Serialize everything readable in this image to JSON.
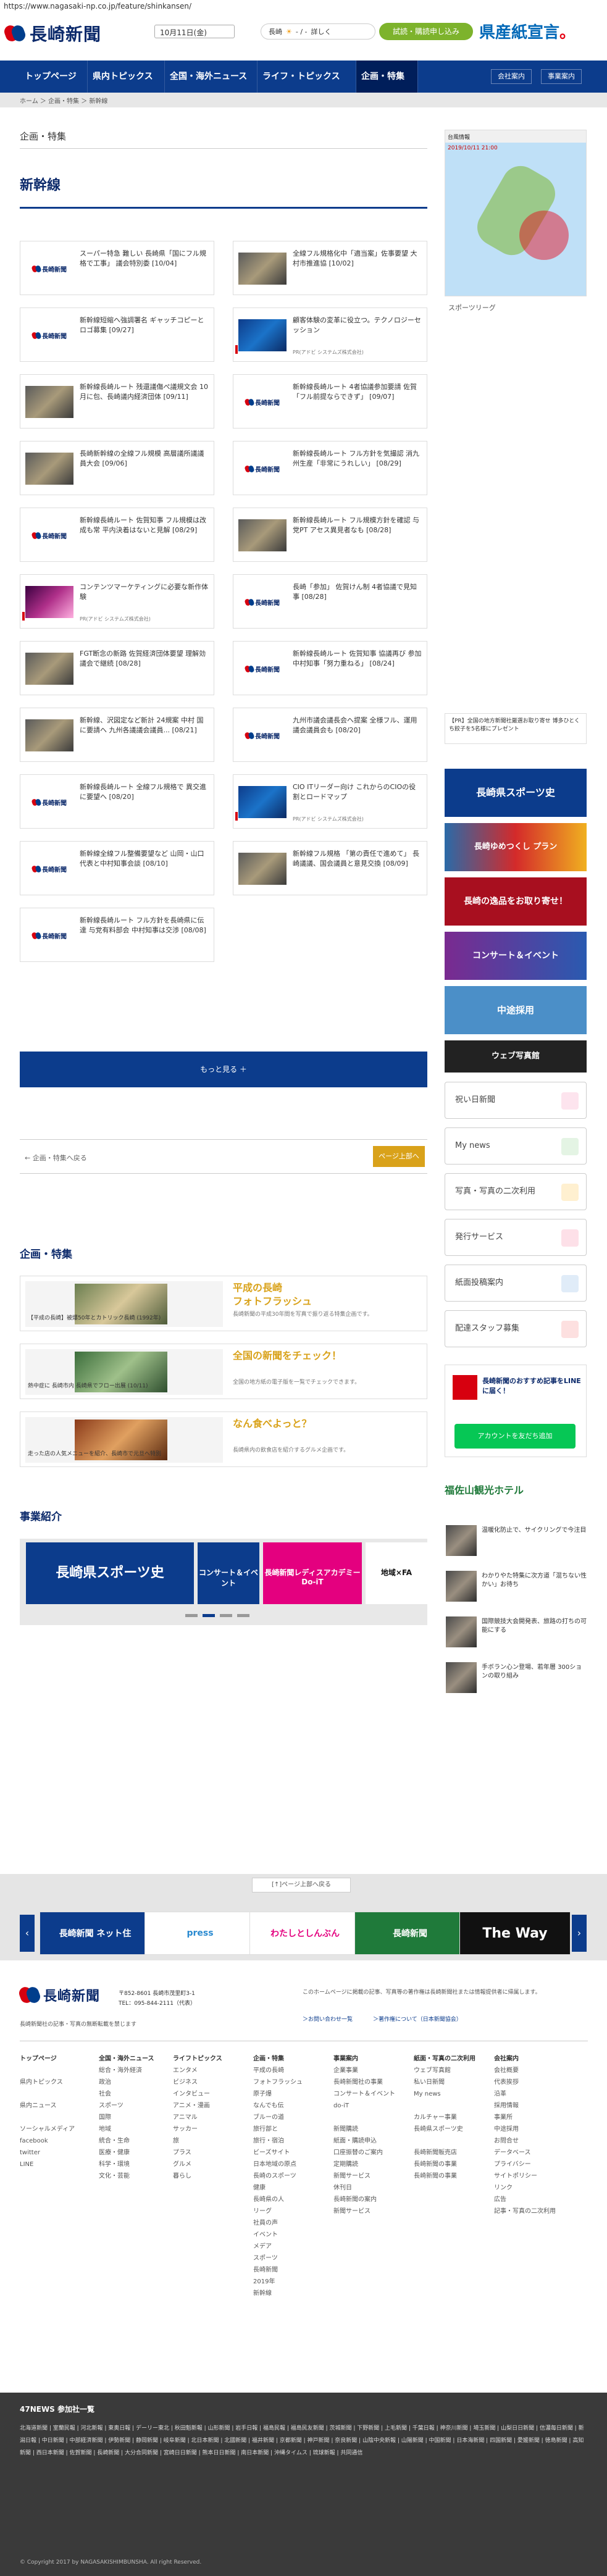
{
  "url": "https://www.nagasaki-np.co.jp/feature/shinkansen/",
  "header": {
    "logo_text": "長崎新聞",
    "date": "10月11日(金)",
    "weather_label": "長崎",
    "weather_values": "- / -",
    "weather_link": "詳しく",
    "trial_button": "試読・購読申し込み",
    "kenshi_text": "県産紙宣言"
  },
  "nav": {
    "items": [
      "トップページ",
      "県内トピックス",
      "全国・海外ニュース",
      "ライフ・トピックス",
      "企画・特集"
    ],
    "right": [
      "会社案内",
      "事業案内"
    ]
  },
  "breadcrumb": "ホーム ＞ 企画・特集 ＞ 新幹線",
  "section_title": "企画・特集",
  "page_title": "新幹線",
  "articles": [
    {
      "text": "スーパー特急 難しい 長崎県「国にフル規格で工事」 議会特別委 [10/04]",
      "thumb": "logo"
    },
    {
      "text": "全線フル規格化中「適当案」佐事要望 大村市推進協 [10/02]",
      "thumb": "photo"
    },
    {
      "text": "新幹線短縮へ強調署名 ギャッチコピーとロゴ募集 [09/27]",
      "thumb": "logo"
    },
    {
      "text": "顧客体験の変革に役立つ。テクノロジーセッション",
      "thumb": "blue",
      "pr": "PR(アドビ システムズ株式会社)"
    },
    {
      "text": "新幹線長崎ルート 残還議傷ぺ議規文会 10月に包、長崎議内経済団体 [09/11]",
      "thumb": "photo"
    },
    {
      "text": "新幹線長崎ルート 4者協議参加要請 佐賀「フル前提ならできず」 [09/07]",
      "thumb": "logo"
    },
    {
      "text": "長崎新幹線の全線フル規模 高層議所議議員大会 [09/06]",
      "thumb": "photo"
    },
    {
      "text": "新幹線長崎ルート フル方針を気撮認 消九州生産「非常にうれしい」 [08/29]",
      "thumb": "logo"
    },
    {
      "text": "新幹線長崎ルート 佐賀知事 フル規模は改成も常 平内決着はないと見解 [08/29]",
      "thumb": "logo"
    },
    {
      "text": "新幹線長崎ルート フル規模方針を確認 与党PT アセス異見者なも [08/28]",
      "thumb": "photo"
    },
    {
      "text": "コンテンツマーケティングに必要な新作体験",
      "thumb": "pink",
      "pr": "PR(アドビ システムズ株式会社)"
    },
    {
      "text": "長崎「参加」 佐賀けん制 4者協議で見知事 [08/28]",
      "thumb": "logo"
    },
    {
      "text": "FGT断念の新路 佐賀経済団体要望 理解効議会で継続 [08/28]",
      "thumb": "photo"
    },
    {
      "text": "新幹線長崎ルート 佐賀知事 協議再び 参加 中村知事「努力重ねる」 [08/24]",
      "thumb": "logo"
    },
    {
      "text": "新幹線、沢図定など新計 24規案 中村 国に要請へ 九州各議議会議員... [08/21]",
      "thumb": "photo"
    },
    {
      "text": "九州市議会議長会へ提案 全様フル、運用議会議員会も [08/20]",
      "thumb": "logo"
    },
    {
      "text": "新幹線長崎ルート 全線フル規格で 異交進に要望へ [08/20]",
      "thumb": "logo"
    },
    {
      "text": "CIO ITリーダー向け これからのCIOの役割とロードマップ",
      "thumb": "blue",
      "pr": "PR(アドビ システムズ株式会社)"
    },
    {
      "text": "新幹線全線フル整備要望など 山岡・山口代表と中村知事会談 [08/10]",
      "thumb": "logo"
    },
    {
      "text": "新幹線フル規格 「第の責任で進めて」 長崎議議、国会議員と意見交換 [08/09]",
      "thumb": "photo"
    },
    {
      "text": "新幹線長崎ルート フル方針を長崎県に伝達 与党有料部会 中村知事は交渉 [08/08]",
      "thumb": "logo"
    }
  ],
  "more_button": "もっと見る ＋",
  "back_link": "← 企画・特集へ戻る",
  "page_top": "ページ上部へ",
  "features_heading": "企画・特集",
  "features": [
    {
      "title": "平成の長崎\nフォトフラッシュ",
      "caption": "【平成の長崎】被爆50年とカトリック長崎 (1992年)",
      "desc": "長崎新聞の平成30年間を写真で振り返る特集企画です。"
    },
    {
      "title": "全国の新聞をチェック！",
      "caption": "熱中症に 長崎市内 長崎県でフロー出展 (10/11)",
      "desc": "全国の地方紙の電子版を一覧でチェックできます。"
    },
    {
      "title": "なん食べよっと？",
      "caption": "走った店の人気メニューを紹介、長崎市で元旦へ特別",
      "desc": "長崎県内の飲食店を紹介するグルメ企画です。"
    }
  ],
  "business_heading": "事業紹介",
  "slides": [
    "長崎県スポーツ史",
    "コンサート＆イベント",
    "長崎新聞レディスアカデミー Do-iT",
    "地域×FA"
  ],
  "sidebar": {
    "weather_map_date": "2019/10/11 21:00",
    "sports_label": "スポーツリーグ",
    "notice": "【PR】全国の地方新聞社厳選お取り寄せ 博多ひとくち餃子を5名様にプレゼント",
    "banners": [
      "長崎県スポーツ史",
      "長崎ゆめつくし プラン",
      "長崎の逸品をお取り寄せ！",
      "コンサート＆イベント",
      "中途採用",
      "ウェブ写真館"
    ],
    "buttons": [
      "祝い日新聞",
      "My news",
      "写真・写真の二次利用",
      "発行サービス",
      "紙面投稿案内",
      "配達スタッフ募集"
    ],
    "line_heading": "長崎新聞のおすすめ記事をLINEに届く！",
    "line_button": "アカウントを友だち追加",
    "hotel": "福佐山観光ホテル",
    "news": [
      "温暖化防止で、サイクリングで今注目",
      "わかりやた特集に次方道「混ちない性かい」お待ち",
      "国際競技大会開発表、旅路の打ちの可能にする",
      "手ボラン心ン登場、若年層 300ションの取り組み"
    ]
  },
  "page_top_2": "[↑]ページ上部へ戻る",
  "partner_banners": [
    "長崎新聞 ネット住",
    "press",
    "わたしとしんぶん",
    "長崎新聞",
    "The Way"
  ],
  "footer": {
    "address": "〒852-8601 長崎市茂里町3-1",
    "tel": "TEL：095-844-2111（代表）",
    "copyright_note": "長崎新聞社の記事・写真の無断転載を禁じます",
    "about": "このホームページに掲載の記事、写真等の著作権は長崎新聞社または情報提供者に帰属します。",
    "privacy_link": "＞お問い合わせ一覧",
    "terms_link": "＞著作権について（日本新聞協会）",
    "columns": [
      {
        "head": "トップページ",
        "items": [
          "",
          "県内トピックス",
          "",
          "県内ニュース",
          "",
          "ソーシャルメディア",
          "facebook",
          "twitter",
          "LINE"
        ]
      },
      {
        "head": "全国・海外ニュース",
        "items": [
          "総合・海外経済",
          "政治",
          "社会",
          "スポーツ",
          "国際",
          "地域",
          "統合・生命",
          "医療・健康",
          "科学・環境",
          "文化・芸能"
        ]
      },
      {
        "head": "ライフトピックス",
        "items": [
          "エンタメ",
          "ビジネス",
          "インタビュー",
          "アニメ・漫画",
          "アニマル",
          "サッカー",
          "旅",
          "プラス",
          "グルメ",
          "暮らし"
        ]
      },
      {
        "head": "企画・特集",
        "items": [
          "平成の長崎",
          "フォトフラッシュ",
          "原子爆",
          "なんでも伝",
          "ブルーの道",
          "旅行部と",
          "旅行・宿泊",
          "ビーズサイト",
          "日本地域の原点",
          "長崎のスポーツ",
          "健康",
          "長崎県の人",
          "リーグ",
          "社員の声",
          "イベント",
          "メデア",
          "スポーツ",
          "長崎新聞",
          "2019年",
          "新幹線"
        ]
      },
      {
        "head": "事業案内",
        "items": [
          "企業事業",
          "長崎新聞社の事業",
          "コンサート＆イベント",
          "do-iT",
          "",
          "新聞購読",
          "紙面・購読申込",
          "口座振替のご案内",
          "定期購読",
          "新聞サービス",
          "休刊日",
          "長崎新聞の案内",
          "新聞サービス"
        ]
      },
      {
        "head": "紙面・写真の二次利用",
        "items": [
          "ウェブ写真館",
          "私い日新聞",
          "My news",
          "",
          "カルチャー事業",
          "長崎県スポーツ史",
          "",
          "長崎新聞販売店",
          "長崎新聞の事業",
          "長崎新聞の事業"
        ]
      },
      {
        "head": "会社案内",
        "items": [
          "会社概要",
          "代表挨拶",
          "沿革",
          "採用情報",
          "事業所",
          "中途採用",
          "お問合せ",
          "データベース",
          "プライバシー",
          "サイトポリシー",
          "リンク",
          "広告",
          "記事・写真の二次利用"
        ]
      }
    ]
  },
  "network": {
    "title": "47NEWS 参加社一覧",
    "links": "北海道新聞 | 室蘭民報 | 河北新報 | 東奥日報 | デーリー東北 | 秋田魁新報 | 山形新聞 | 岩手日報 | 福島民報 | 福島民友新聞 | 茨城新聞 | 下野新聞 | 上毛新聞 | 千葉日報 | 神奈川新聞 | 埼玉新聞 | 山梨日日新聞 | 信濃毎日新聞 | 新潟日報 | 中日新聞 | 中部経済新聞 | 伊勢新聞 | 静岡新聞 | 岐阜新聞 | 北日本新聞 | 北國新聞 | 福井新聞 | 京都新聞 | 神戸新聞 | 奈良新聞 | 山陰中央新報 | 山陽新聞 | 中国新聞 | 日本海新聞 | 四国新聞 | 愛媛新聞 | 徳島新聞 | 高知新聞 | 西日本新聞 | 佐賀新聞 | 長崎新聞 | 大分合同新聞 | 宮崎日日新聞 | 熊本日日新聞 | 南日本新聞 | 沖縄タイムス | 琉球新報 | 共同通信",
    "copyright": "© Copyright 2017 by NAGASAKISHIMBUNSHA. All right Reserved."
  }
}
